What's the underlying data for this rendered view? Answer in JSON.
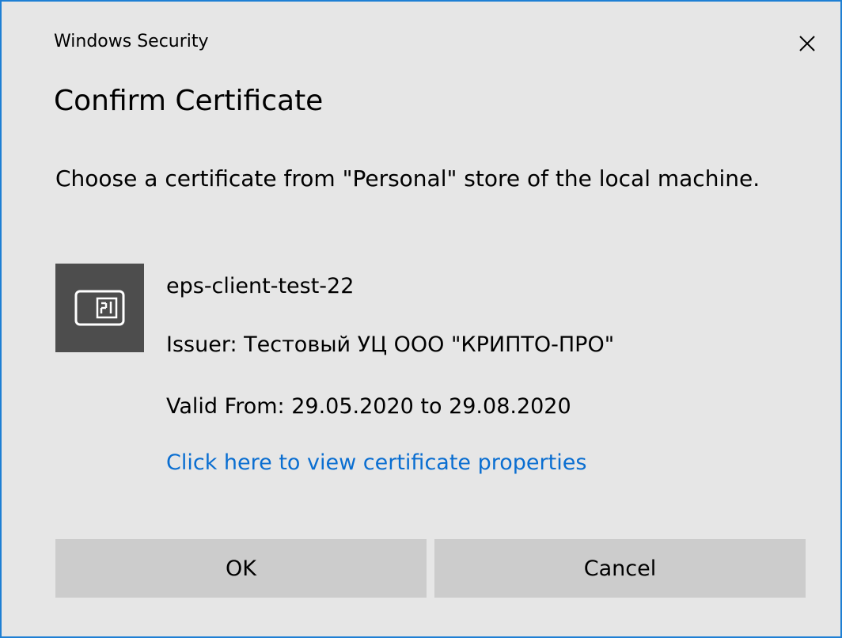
{
  "window": {
    "title": "Windows Security",
    "close_icon": "close-icon",
    "accent_color": "#1e7fd4"
  },
  "dialog": {
    "heading": "Confirm Certificate",
    "description": "Choose a certificate from \"Personal\" store of the local machine."
  },
  "certificate": {
    "icon": "certificate-card-icon",
    "name": "eps-client-test-22",
    "issuer": "Issuer: Тестовый УЦ ООО \"КРИПТО-ПРО\"",
    "valid": "Valid From: 29.05.2020 to 29.08.2020",
    "properties_link": "Click here to view certificate properties",
    "link_color": "#0a6ed1"
  },
  "buttons": {
    "ok_label": "OK",
    "cancel_label": "Cancel"
  }
}
